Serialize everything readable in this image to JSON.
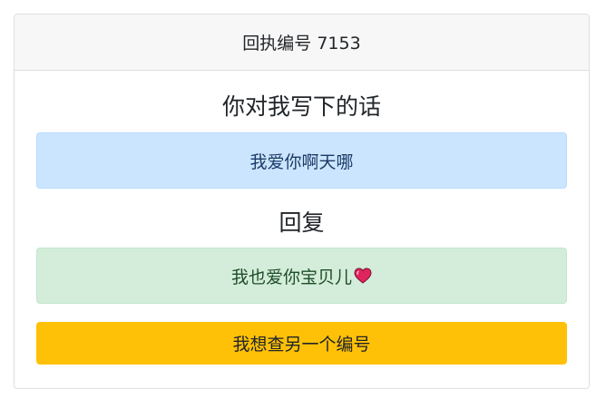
{
  "card": {
    "header": "回执编号 7153"
  },
  "message": {
    "title": "你对我写下的话",
    "text": "我爱你啊天哪"
  },
  "reply": {
    "title": "回复",
    "text": "我也爱你宝贝儿",
    "emoji_icon": "heart-icon"
  },
  "actions": {
    "lookup_label": "我想查另一个编号"
  },
  "colors": {
    "info_bg": "#cce5ff",
    "success_bg": "#d4edda",
    "warning_bg": "#ffc107",
    "heart": "#e0245e"
  }
}
